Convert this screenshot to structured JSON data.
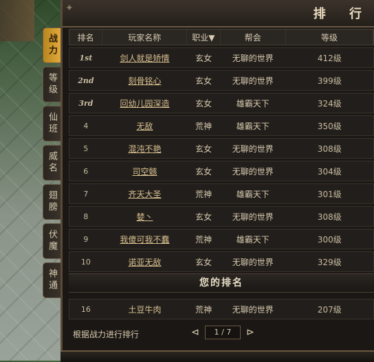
{
  "panel": {
    "title": "排 行",
    "ornament": "✦"
  },
  "tabs": [
    {
      "label": "战力",
      "active": true
    },
    {
      "label": "等级"
    },
    {
      "label": "仙班"
    },
    {
      "label": "威名"
    },
    {
      "label": "翅膀"
    },
    {
      "label": "伏魔"
    },
    {
      "label": "神通"
    }
  ],
  "table": {
    "headers": {
      "rank": "排名",
      "name": "玩家名称",
      "job": "职业▼",
      "guild": "帮会",
      "level": "等级"
    },
    "rows": [
      {
        "rank": "1st",
        "name": "剑人就是矫情",
        "job": "玄女",
        "guild": "无聊的世界",
        "level": "412级"
      },
      {
        "rank": "2nd",
        "name": "刻骨铭心",
        "job": "玄女",
        "guild": "无聊的世界",
        "level": "399级"
      },
      {
        "rank": "3rd",
        "name": "回幼儿园深造",
        "job": "玄女",
        "guild": "雄霸天下",
        "level": "324级"
      },
      {
        "rank": "4",
        "name": "无敌",
        "job": "荒神",
        "guild": "雄霸天下",
        "level": "350级"
      },
      {
        "rank": "5",
        "name": "混沌不艳",
        "job": "玄女",
        "guild": "无聊的世界",
        "level": "308级"
      },
      {
        "rank": "6",
        "name": "司空骸",
        "job": "玄女",
        "guild": "无聊的世界",
        "level": "304级"
      },
      {
        "rank": "7",
        "name": "齐天大圣",
        "job": "荒神",
        "guild": "雄霸天下",
        "level": "301级"
      },
      {
        "rank": "8",
        "name": "婪丶",
        "job": "玄女",
        "guild": "无聊的世界",
        "level": "308级"
      },
      {
        "rank": "9",
        "name": "我傻可我不蠢",
        "job": "荒神",
        "guild": "雄霸天下",
        "level": "300级"
      },
      {
        "rank": "10",
        "name": "诺亚无敌",
        "job": "玄女",
        "guild": "无聊的世界",
        "level": "329级"
      }
    ]
  },
  "yours": {
    "header": "您的排名",
    "row": {
      "rank": "16",
      "name": "土豆牛肉",
      "job": "荒神",
      "guild": "无聊的世界",
      "level": "207级"
    }
  },
  "footer": {
    "note": "根据战力进行排行",
    "prev_icon": "⊲",
    "next_icon": "⊳",
    "page": "1 / 7"
  }
}
